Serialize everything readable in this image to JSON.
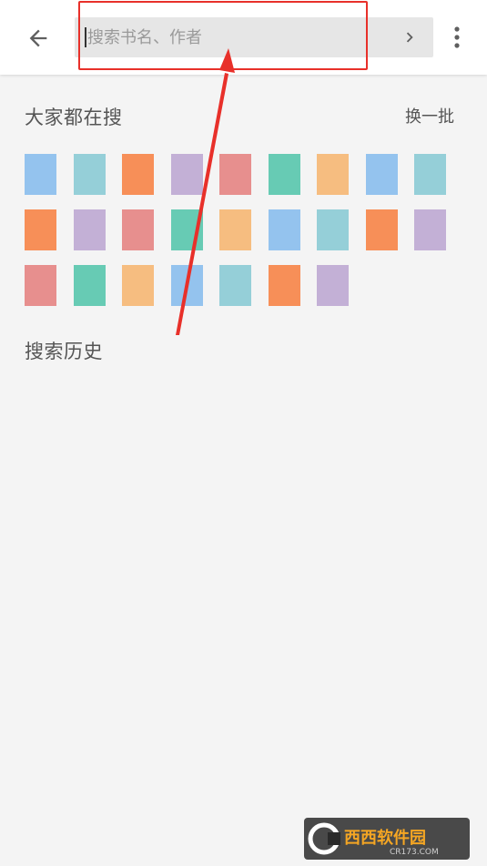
{
  "header": {
    "back_icon": "arrow-left-icon",
    "search_placeholder": "搜索书名、作者",
    "search_value": "",
    "go_icon": "chevron-right-icon",
    "more_icon": "more-vertical-icon"
  },
  "hot": {
    "title": "大家都在搜",
    "refresh_label": "换一批",
    "tile_colors": [
      "#94c3ee",
      "#95cfd8",
      "#f78f58",
      "#c3b0d6",
      "#e78f8e",
      "#67cbb4",
      "#f6bd80",
      "#94c3ee",
      "#95cfd8",
      "#f78f58",
      "#c3b0d6",
      "#e78f8e",
      "#67cbb4",
      "#f6bd80",
      "#94c3ee",
      "#95cfd8",
      "#f78f58",
      "#c3b0d6",
      "#e78f8e",
      "#67cbb4",
      "#f6bd80",
      "#94c3ee",
      "#95cfd8",
      "#f78f58",
      "#c3b0d6"
    ]
  },
  "history": {
    "title": "搜索历史"
  },
  "colors": {
    "accent_red": "#e8302a",
    "background": "#f4f4f4",
    "search_bg": "#e6e6e6"
  },
  "watermark": {
    "text": "西西软件园",
    "subtext": "CR173.COM"
  }
}
